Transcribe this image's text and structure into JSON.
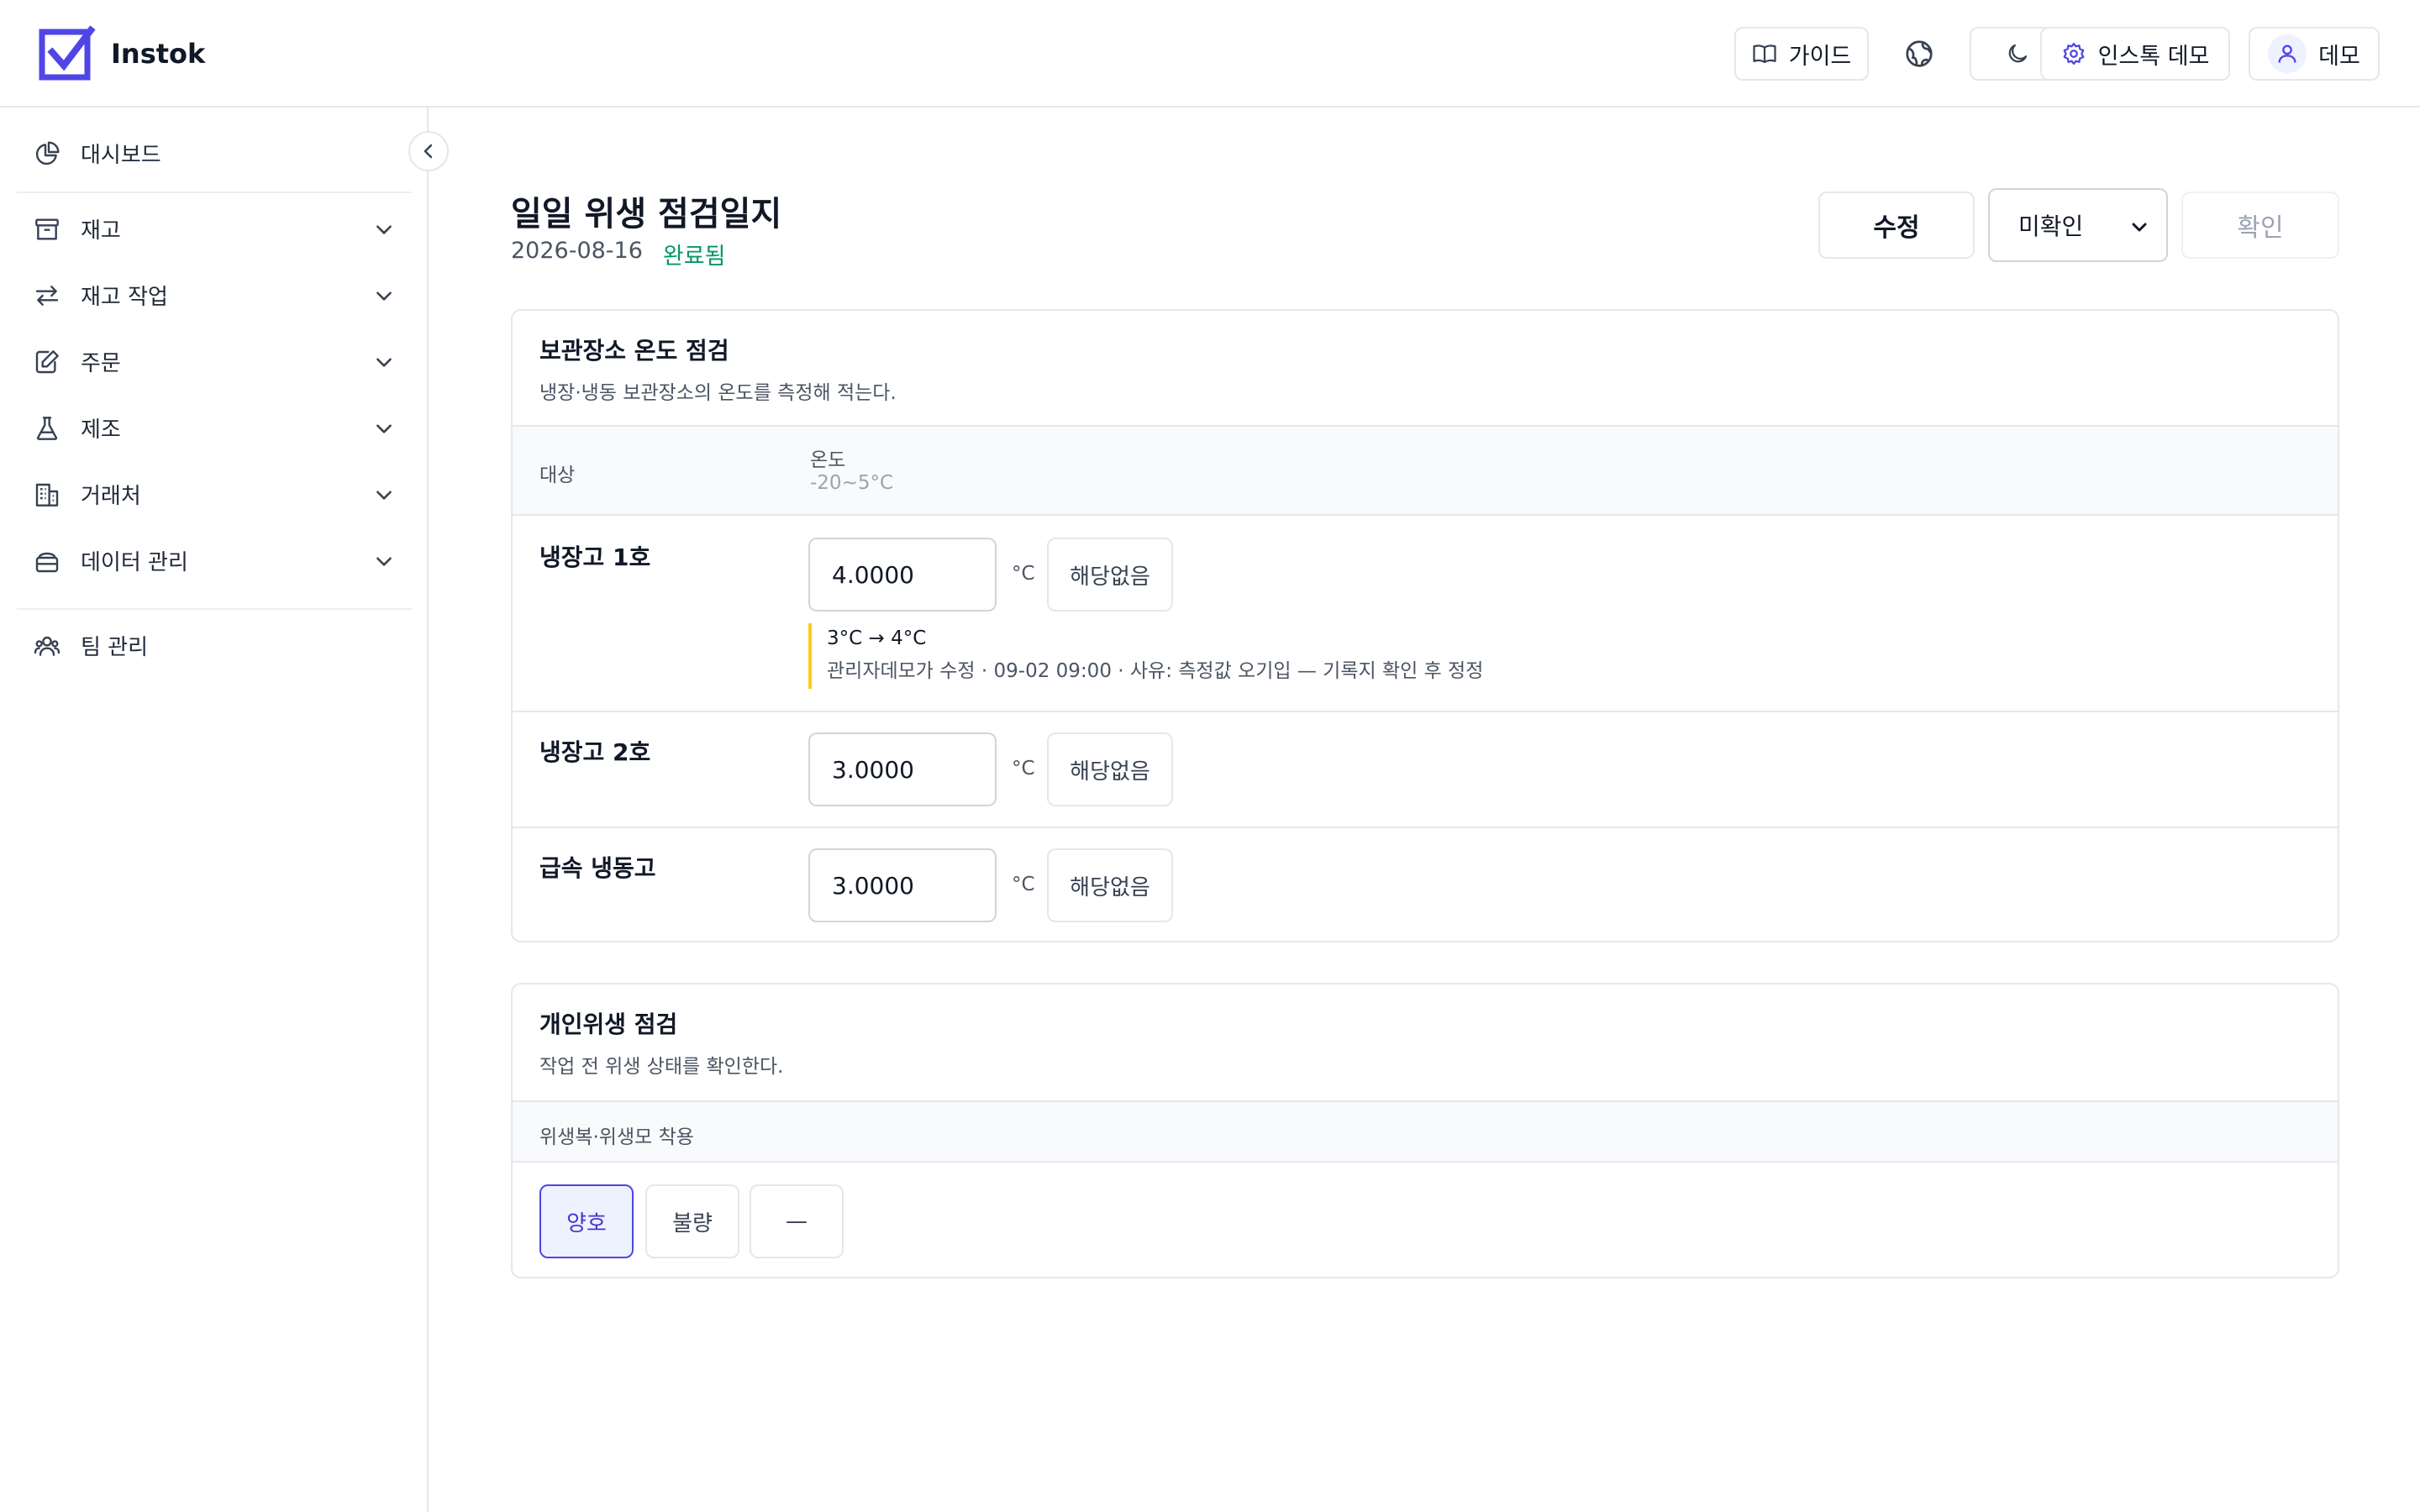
{
  "app": {
    "name": "Instok",
    "brand_color": "#4f46e5"
  },
  "header": {
    "guide_label": "가이드",
    "org_label": "인스톡 데모",
    "user_label": "데모",
    "icons": [
      "book-open-icon",
      "globe-icon",
      "moon-icon",
      "gear-icon",
      "user-icon"
    ]
  },
  "sidebar": {
    "items": [
      {
        "label": "대시보드",
        "icon": "pie-chart-icon"
      },
      {
        "label": "재고",
        "icon": "archive-icon"
      },
      {
        "label": "재고 작업",
        "icon": "arrows-exchange-icon"
      },
      {
        "label": "주문",
        "icon": "edit-note-icon"
      },
      {
        "label": "제조",
        "icon": "flask-icon"
      },
      {
        "label": "거래처",
        "icon": "building-icon"
      },
      {
        "label": "데이터 관리",
        "icon": "database-icon"
      },
      {
        "label": "팀 관리",
        "icon": "users-icon"
      }
    ]
  },
  "page": {
    "title": "일일 위생 점검일지",
    "date": "2026-08-16",
    "status": "완료됨",
    "status_color": "#059669",
    "edit_label": "수정",
    "review_select": "미확인",
    "confirm_label": "확인"
  },
  "storage_section": {
    "title": "보관장소 온도 점검",
    "description": "냉장·냉동 보관장소의 온도를 측정해 적는다.",
    "col_target": "대상",
    "col_temp": "온도",
    "col_temp_range": "-20~5°C",
    "unit": "°C",
    "na_label": "해당없음",
    "rows": [
      {
        "name": "냉장고 1호",
        "value": "4.0000"
      },
      {
        "name": "냉장고 2호",
        "value": "3.0000"
      },
      {
        "name": "급속 냉동고",
        "value": "3.0000"
      }
    ],
    "change_note": {
      "change": "3°C → 4°C",
      "detail": "관리자데모가 수정 · 09-02 09:00 · 사유: 측정값 오기입 — 기록지 확인 후 정정"
    }
  },
  "hygiene_section": {
    "title": "개인위생 점검",
    "description": "작업 전 위생 상태를 확인한다.",
    "item_label": "위생복·위생모 착용",
    "options": [
      "양호",
      "불량",
      "—"
    ],
    "selected": "양호"
  }
}
